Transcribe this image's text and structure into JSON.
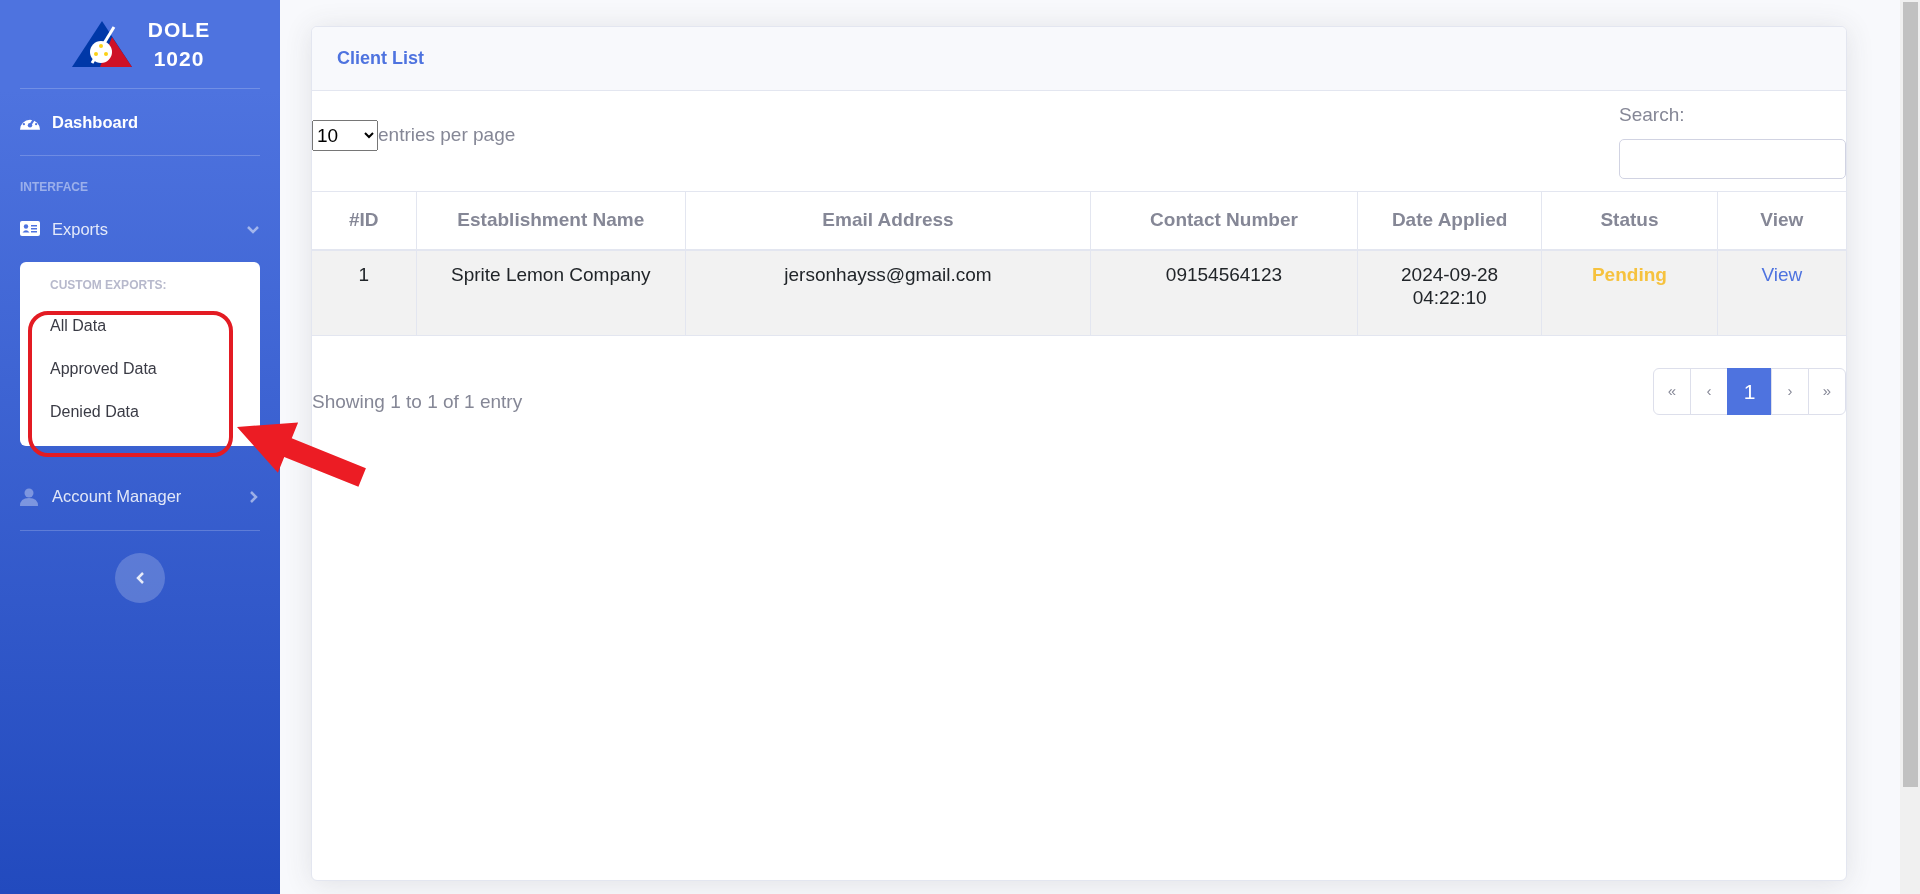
{
  "sidebar": {
    "brand": {
      "lines": [
        "DOLE",
        "1020"
      ]
    },
    "dashboard": {
      "label": "Dashboard",
      "selected": true
    },
    "heading": "INTERFACE",
    "items": [
      {
        "label": "Exports",
        "expanded": true,
        "submenu": {
          "heading": "CUSTOM EXPORTS:",
          "children": [
            {
              "label": "All Data"
            },
            {
              "label": "Approved Data"
            },
            {
              "label": "Denied Data"
            }
          ]
        }
      },
      {
        "label": "Account Manager",
        "expanded": false
      }
    ]
  },
  "card": {
    "title": "Client List",
    "length": {
      "value": "10",
      "label": "entries per page"
    },
    "search": {
      "label": "Search:"
    },
    "table": {
      "columns": [
        "#ID",
        "Establishment Name",
        "Email Address",
        "Contact Number",
        "Date Applied",
        "Status",
        "View"
      ],
      "rows": [
        {
          "id": "1",
          "name": "Sprite Lemon Company",
          "email": "jersonhayss@gmail.com",
          "contact": "09154564123",
          "date": [
            "2024-09-28",
            "04:22:10"
          ],
          "status": "Pending",
          "view": "View"
        }
      ]
    },
    "info": "Showing 1 to 1 of 1 entry",
    "pagination": [
      {
        "label": "«",
        "selected": false
      },
      {
        "label": "‹",
        "selected": false
      },
      {
        "label": "1",
        "selected": true
      },
      {
        "label": "›",
        "selected": false
      },
      {
        "label": "»",
        "selected": false
      }
    ]
  }
}
